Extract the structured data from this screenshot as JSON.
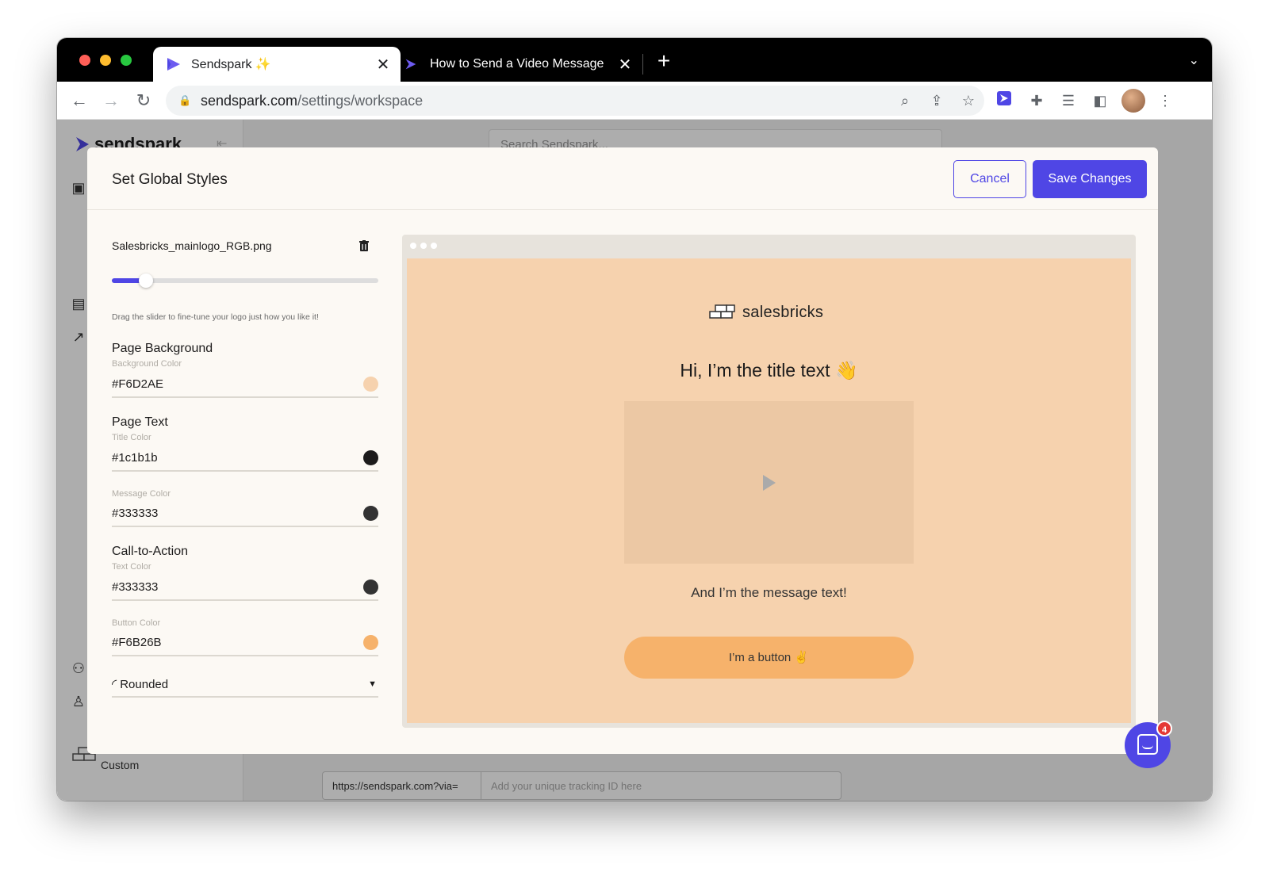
{
  "browser": {
    "tabs": [
      {
        "title": "Sendspark",
        "sparkle": "✨"
      },
      {
        "title": "How to Send a Video Message"
      }
    ],
    "close_glyph": "✕",
    "new_tab_glyph": "+",
    "url_domain": "sendspark.com",
    "url_path": "/settings/workspace"
  },
  "app": {
    "brand": "sendspark",
    "search_placeholder": "Search Sendspark...",
    "plan_label": "Custom",
    "tracking_prefix": "https://sendspark.com?via=",
    "tracking_placeholder": "Add your unique tracking ID here"
  },
  "modal": {
    "title": "Set Global Styles",
    "cancel_label": "Cancel",
    "save_label": "Save Changes",
    "logo_file": "Salesbricks_mainlogo_RGB.png",
    "slider_fraction": 0.1,
    "slider_help": "Drag the slider to fine-tune your logo just how you like it!",
    "page_background": {
      "title": "Page Background",
      "label": "Background Color",
      "value": "#F6D2AE",
      "swatch": "#F6D2AE"
    },
    "page_text": {
      "title": "Page Text",
      "title_color_label": "Title Color",
      "title_color": "#1c1b1b",
      "message_color_label": "Message Color",
      "message_color": "#333333"
    },
    "cta": {
      "title": "Call-to-Action",
      "text_color_label": "Text Color",
      "text_color": "#333333",
      "button_color_label": "Button Color",
      "button_color": "#F6B26B"
    },
    "button_shape": "Rounded"
  },
  "preview": {
    "logo_text": "salesbricks",
    "title": "Hi, I’m the title text 👋",
    "message": "And I’m the message text!",
    "button": "I’m a button ✌️"
  },
  "chat": {
    "badge": "4"
  },
  "colors": {
    "accent": "#4f46e5"
  }
}
